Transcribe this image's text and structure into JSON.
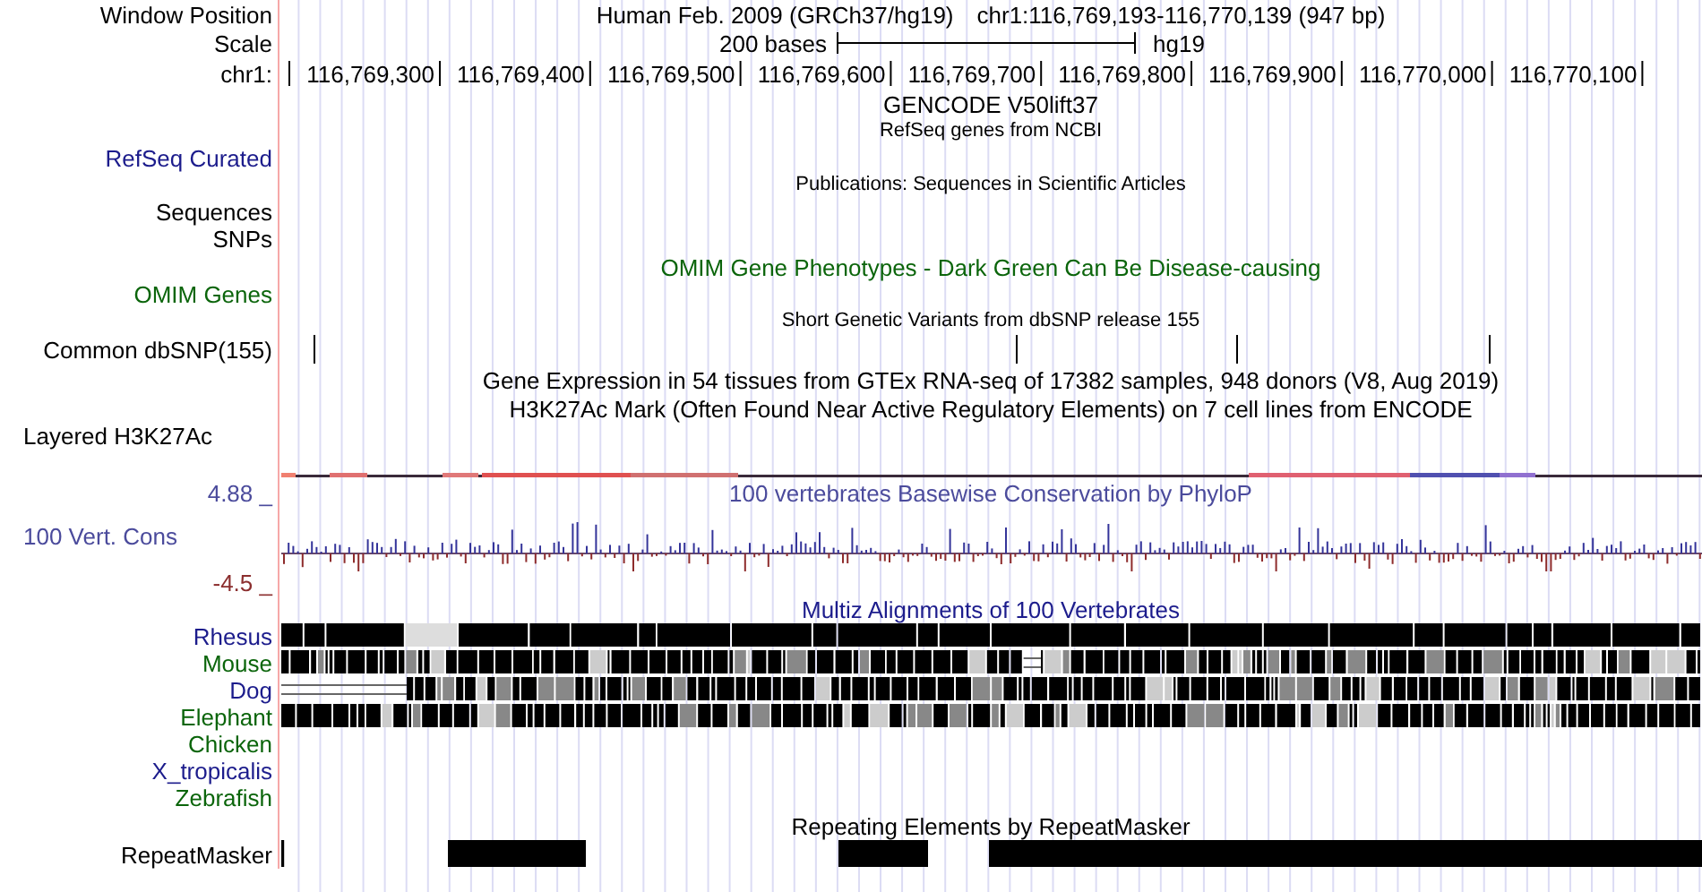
{
  "rows": [
    {
      "kind": "header",
      "label": "Window Position",
      "assembly": "Human Feb. 2009 (GRCh37/hg19)",
      "position": "chr1:116,769,193-116,770,139 (947 bp)"
    },
    {
      "kind": "scale",
      "label": "Scale",
      "length": "200 bases",
      "genome": "hg19"
    },
    {
      "kind": "ruler",
      "label": "chr1:",
      "ticks": [
        "116,769,300",
        "116,769,400",
        "116,769,500",
        "116,769,600",
        "116,769,700",
        "116,769,800",
        "116,769,900",
        "116,770,000",
        "116,770,100"
      ]
    },
    {
      "kind": "title",
      "text": "GENCODE V50lift37"
    },
    {
      "kind": "caption",
      "text": "RefSeq genes from NCBI"
    },
    {
      "kind": "label",
      "label": "RefSeq Curated",
      "color": "#1c1c8c"
    },
    {
      "kind": "caption",
      "text": "Publications: Sequences in Scientific Articles"
    },
    {
      "kind": "label",
      "label": "Sequences",
      "color": "#000000"
    },
    {
      "kind": "label",
      "label": "SNPs",
      "color": "#000000"
    },
    {
      "kind": "title",
      "text": "OMIM Gene Phenotypes - Dark Green Can Be Disease-causing",
      "color": "#0b650b"
    },
    {
      "kind": "label",
      "label": "OMIM Genes",
      "color": "#0b650b"
    },
    {
      "kind": "caption",
      "text": "Short Genetic Variants from dbSNP release 155"
    },
    {
      "kind": "snps",
      "label": "Common dbSNP(155)",
      "color": "#000000"
    },
    {
      "kind": "title",
      "text": "Gene Expression in 54 tissues from GTEx RNA-seq of 17382 samples, 948 donors (V8, Aug 2019)"
    },
    {
      "kind": "title",
      "text": "H3K27Ac Mark (Often Found Near Active Regulatory Elements) on 7 cell lines from ENCODE"
    },
    {
      "kind": "group_label",
      "label": "Layered H3K27Ac",
      "color": "#000000"
    },
    {
      "kind": "signal"
    },
    {
      "kind": "cons_top",
      "label": "4.88 _",
      "text": "100 vertebrates Basewise Conservation by PhyloP",
      "color": "#4b4b9c"
    },
    {
      "kind": "cons",
      "label": "100 Vert. Cons",
      "color": "#4b4b9c"
    },
    {
      "kind": "cons_bottom",
      "label": "-4.5 _",
      "color": "#8b2e2e"
    },
    {
      "kind": "title",
      "text": "Multiz Alignments of 100 Vertebrates",
      "color": "#1c1c8c"
    },
    {
      "kind": "alignment",
      "label": "Rhesus",
      "color": "#1c1c8c",
      "aligned": true
    },
    {
      "kind": "alignment",
      "label": "Mouse",
      "color": "#0b650b",
      "aligned": true
    },
    {
      "kind": "alignment",
      "label": "Dog",
      "color": "#1c1c8c",
      "aligned": true
    },
    {
      "kind": "alignment",
      "label": "Elephant",
      "color": "#0b650b",
      "aligned": true
    },
    {
      "kind": "alignment",
      "label": "Chicken",
      "color": "#0b650b",
      "aligned": false
    },
    {
      "kind": "alignment",
      "label": "X_tropicalis",
      "color": "#1c1c8c",
      "aligned": false
    },
    {
      "kind": "alignment",
      "label": "Zebrafish",
      "color": "#0b650b",
      "aligned": false
    },
    {
      "kind": "title",
      "text": "Repeating Elements by RepeatMasker"
    },
    {
      "kind": "repeat",
      "label": "RepeatMasker",
      "color": "#000000"
    }
  ]
}
